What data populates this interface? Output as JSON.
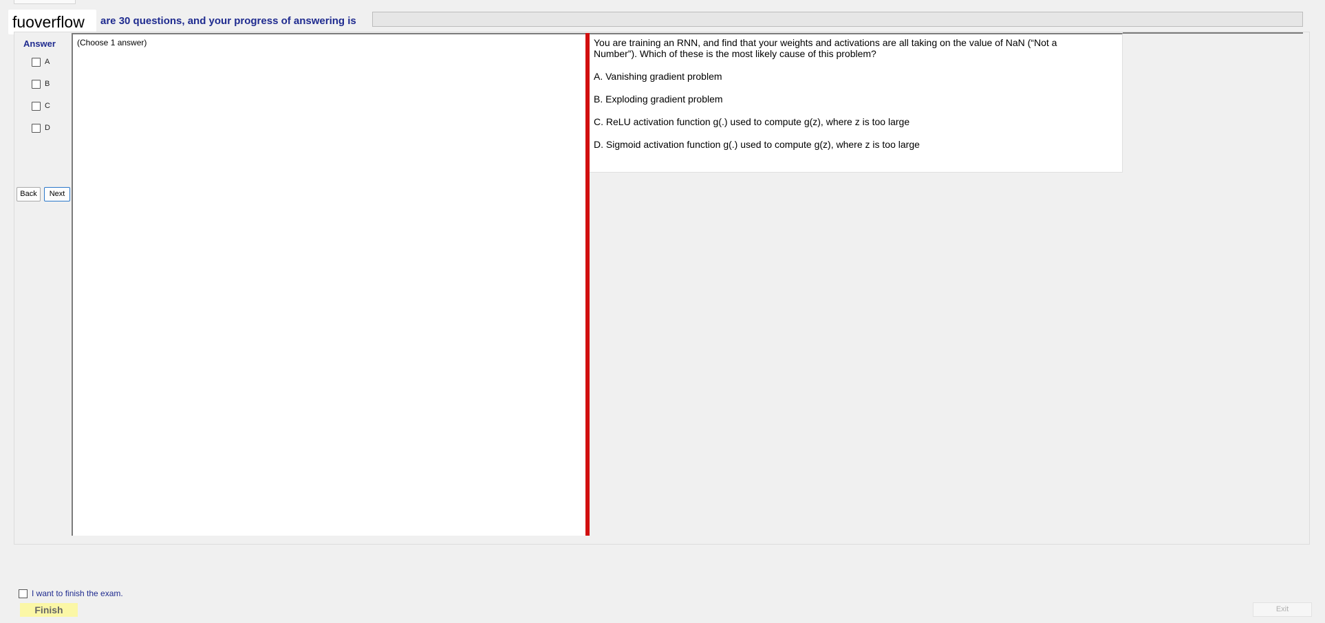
{
  "header": {
    "watermark": "fuoverflow",
    "progress_text": "are 30 questions, and your progress of answering is",
    "progress_percent": 0
  },
  "answer_panel": {
    "title": "Answer",
    "options": [
      "A",
      "B",
      "C",
      "D"
    ],
    "back_label": "Back",
    "next_label": "Next"
  },
  "left_pane": {
    "instruction": "(Choose 1 answer)"
  },
  "question": {
    "text": "You are training an RNN, and find that your weights and activations are all taking on the value of NaN (“Not a Number”). Which of these is the most likely cause of this problem?",
    "options": [
      "A.  Vanishing gradient problem",
      "B.  Exploding gradient problem",
      "C.  ReLU activation function g(.) used to compute g(z), where z is too large",
      "D.  Sigmoid activation function g(.) used to compute g(z), where z is too large"
    ]
  },
  "footer": {
    "finish_checkbox_label": "I want to finish the exam.",
    "finish_label": "Finish",
    "exit_label": "Exit"
  },
  "colors": {
    "accent_blue": "#1f2b8f",
    "splitter_red": "#d10f0f",
    "finish_yellow": "#fbf7a6"
  }
}
